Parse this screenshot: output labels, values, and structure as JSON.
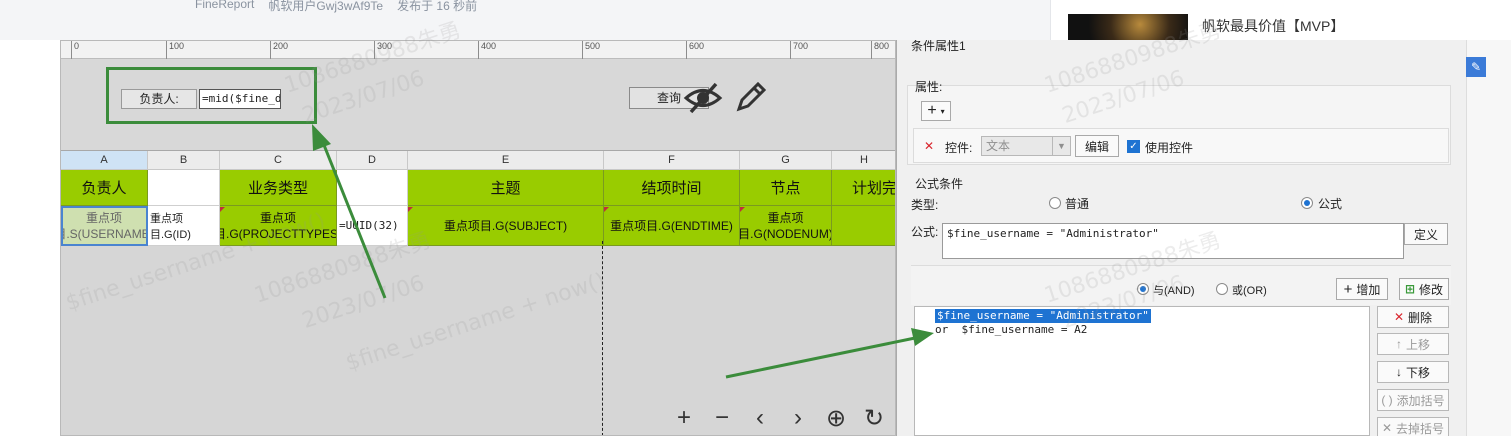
{
  "forum": {
    "meta": [
      "FineReport",
      "帆软用户Gwj3wAf9Te",
      "发布于 16 秒前"
    ],
    "sidebar_title": "帆软最具价值【MVP】"
  },
  "designer": {
    "ruler_ticks": [
      "0",
      "100",
      "200",
      "300",
      "400",
      "500",
      "600",
      "700",
      "800"
    ],
    "param": {
      "label": "负责人:",
      "input_value": "=mid($fine_di",
      "query_button": "查询"
    },
    "columns": [
      "A",
      "B",
      "C",
      "D",
      "E",
      "F",
      "G",
      "H"
    ],
    "header_row": [
      "负责人",
      "",
      "业务类型",
      "",
      "主题",
      "结项时间",
      "节点",
      "计划完"
    ],
    "data_row": [
      "重点项目.S(USERNAME)",
      "重点项目.G(ID)",
      "重点项目.G(PROJECTTYPES)",
      "=UUID(32)",
      "重点项目.G(SUBJECT)",
      "重点项目.G(ENDTIME)",
      "重点项目.G(NODENUM)",
      ""
    ],
    "zoom_controls": [
      "+",
      "−",
      "‹",
      "›",
      "⊕",
      "↻"
    ]
  },
  "dialog": {
    "title": "条件属性1",
    "attr_label": "属性:",
    "add_symbol": "+",
    "control_label": "控件:",
    "control_value": "文本",
    "edit_button": "编辑",
    "use_control_label": "使用控件",
    "formula_section": "公式条件",
    "type_label": "类型:",
    "type_normal": "普通",
    "type_formula": "公式",
    "formula_label": "公式:",
    "formula_value": "$fine_username = \"Administrator\"",
    "define_button": "定义",
    "and_label": "与(AND)",
    "or_label": "或(OR)",
    "add_button": "增加",
    "modify_button": "修改",
    "conditions": [
      "$fine_username = \"Administrator\"",
      "or  $fine_username = A2"
    ],
    "delete_button": "删除",
    "up_button": "上移",
    "down_button": "下移",
    "add_bracket_button": "添加括号",
    "remove_bracket_button": "去掉括号"
  },
  "watermark": {
    "id": "1086880988朱勇",
    "date": "2023/07/06",
    "formula": "$fine_username + now()"
  },
  "colors": {
    "header_green": "#99cc00",
    "annotation_green": "#3b8c3b",
    "selection_blue": "#1e73d2"
  }
}
